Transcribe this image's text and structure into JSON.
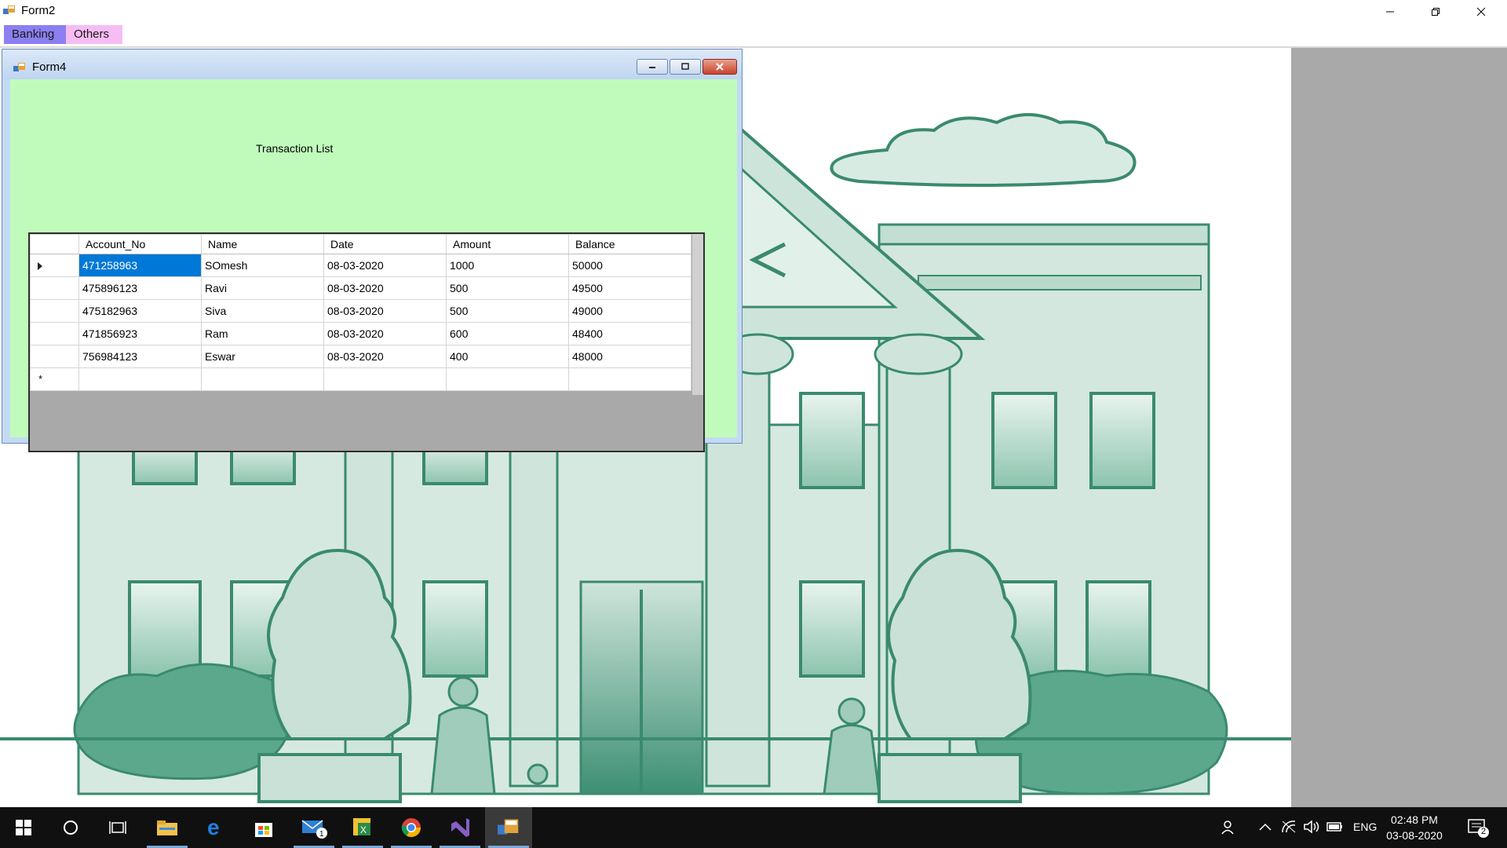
{
  "main_window": {
    "title": "Form2",
    "controls": [
      "minimize",
      "restore",
      "close"
    ]
  },
  "menu": {
    "items": [
      {
        "label": "Banking",
        "color": "#8b7ff1"
      },
      {
        "label": "Others",
        "color": "#f6bdf4"
      }
    ]
  },
  "child_window": {
    "title": "Form4",
    "body_color": "#c0fbbc",
    "heading": "Transaction List",
    "grid": {
      "columns": [
        "Account_No",
        "Name",
        "Date",
        "Amount",
        "Balance"
      ],
      "rows": [
        {
          "account_no": "471258963",
          "name": "SOmesh",
          "date": "08-03-2020",
          "amount": "1000",
          "balance": "50000"
        },
        {
          "account_no": "475896123",
          "name": "Ravi",
          "date": "08-03-2020",
          "amount": "500",
          "balance": "49500"
        },
        {
          "account_no": "475182963",
          "name": "Siva",
          "date": "08-03-2020",
          "amount": "500",
          "balance": "49000"
        },
        {
          "account_no": "471856923",
          "name": "Ram",
          "date": "08-03-2020",
          "amount": "600",
          "balance": "48400"
        },
        {
          "account_no": "756984123",
          "name": "Eswar",
          "date": "08-03-2020",
          "amount": "400",
          "balance": "48000"
        }
      ],
      "selected_row": 0,
      "new_row_marker": "*"
    }
  },
  "background": {
    "illustration": "bank-building-with-lions",
    "tint": "#5aa88f"
  },
  "taskbar": {
    "apps": [
      "start-icon",
      "search-icon",
      "task-view-icon",
      "file-explorer-icon",
      "edge-icon",
      "store-icon",
      "mail-icon",
      "excel-like-icon",
      "chrome-icon",
      "visual-studio-icon",
      "winforms-app-icon"
    ],
    "mail_badge": "1",
    "tray": {
      "language": "ENG",
      "time": "02:48 PM",
      "date": "03-08-2020",
      "notification_count": "2"
    }
  }
}
